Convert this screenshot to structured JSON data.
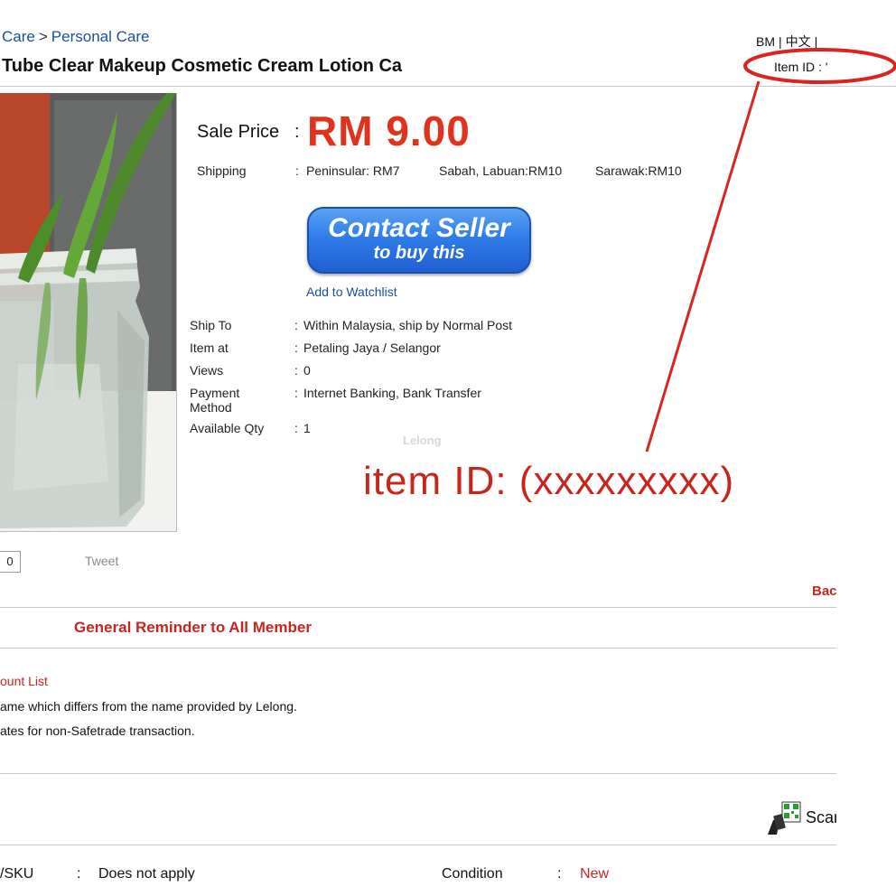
{
  "breadcrumb": {
    "items": [
      "Care",
      "Personal Care"
    ],
    "separator": ">"
  },
  "language": {
    "bm": "BM",
    "sep1": "|",
    "zh": "中文",
    "sep2": "|"
  },
  "item_id_top": "Item ID : '",
  "product": {
    "title": "Tube Clear Makeup Cosmetic Cream Lotion Ca"
  },
  "sale": {
    "label": "Sale Price",
    "colon": ":",
    "price": "RM 9.00"
  },
  "shipping": {
    "label": "Shipping",
    "colon": ":",
    "peninsular": "Peninsular: RM7",
    "sabah": "Sabah, Labuan:RM10",
    "sarawak": "Sarawak:RM10"
  },
  "contact": {
    "line1": "Contact Seller",
    "line2": "to buy this"
  },
  "watchlist": "Add to Watchlist",
  "details": [
    {
      "label": "Ship To",
      "value": "Within Malaysia, ship by Normal Post"
    },
    {
      "label": "Item at",
      "value": "Petaling Jaya / Selangor"
    },
    {
      "label": "Views",
      "value": "0"
    },
    {
      "label": "Payment Method",
      "value": "Internet Banking, Bank Transfer"
    },
    {
      "label": "Available Qty",
      "value": "1"
    }
  ],
  "detail_colon": ":",
  "watermark": "Lelong",
  "annotation": {
    "text": "item ID: (xxxxxxxxx)",
    "color": "#c8251f"
  },
  "social": {
    "like_count": "0",
    "tweet": "Tweet"
  },
  "back_link": "Bac",
  "reminder": {
    "title": "General Reminder to All Member",
    "account_list": "ount List",
    "line1": "ame which differs from the name provided by Lelong.",
    "line2": "ates for non-Safetrade transaction."
  },
  "scan": {
    "label": "Scar",
    "icon": "qr-scan-icon"
  },
  "sku": {
    "label": "/SKU",
    "colon": ":",
    "value": "Does not apply"
  },
  "condition": {
    "label": "Condition",
    "colon": ":",
    "value": "New"
  },
  "colors": {
    "accent_red": "#e0321c",
    "link_blue": "#1a4f9c",
    "button_blue": "#2f7de8"
  }
}
